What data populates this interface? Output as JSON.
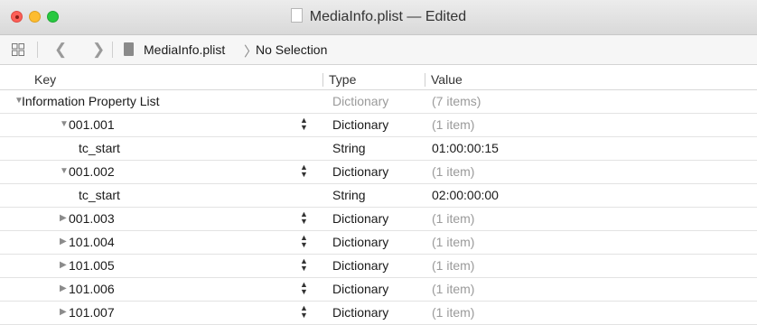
{
  "window": {
    "title": "MediaInfo.plist — Edited"
  },
  "jumpbar": {
    "file": "MediaInfo.plist",
    "selection": "No Selection"
  },
  "columns": {
    "key": "Key",
    "type": "Type",
    "value": "Value"
  },
  "rows": [
    {
      "key": "Information Property List",
      "type": "Dictionary",
      "value": "(7 items)",
      "disclosure": "expanded",
      "depth": 0,
      "stepper": false,
      "type_dim": true
    },
    {
      "key": "001.001",
      "type": "Dictionary",
      "value": "(1 item)",
      "disclosure": "expanded",
      "depth": 1,
      "stepper": true,
      "type_dim": false
    },
    {
      "key": "tc_start",
      "type": "String",
      "value": "01:00:00:15",
      "disclosure": "none",
      "depth": 2,
      "stepper": false,
      "type_dim": false
    },
    {
      "key": "001.002",
      "type": "Dictionary",
      "value": "(1 item)",
      "disclosure": "expanded",
      "depth": 1,
      "stepper": true,
      "type_dim": false
    },
    {
      "key": "tc_start",
      "type": "String",
      "value": "02:00:00:00",
      "disclosure": "none",
      "depth": 2,
      "stepper": false,
      "type_dim": false
    },
    {
      "key": "001.003",
      "type": "Dictionary",
      "value": "(1 item)",
      "disclosure": "collapsed",
      "depth": 1,
      "stepper": true,
      "type_dim": false
    },
    {
      "key": "101.004",
      "type": "Dictionary",
      "value": "(1 item)",
      "disclosure": "collapsed",
      "depth": 1,
      "stepper": true,
      "type_dim": false
    },
    {
      "key": "101.005",
      "type": "Dictionary",
      "value": "(1 item)",
      "disclosure": "collapsed",
      "depth": 1,
      "stepper": true,
      "type_dim": false
    },
    {
      "key": "101.006",
      "type": "Dictionary",
      "value": "(1 item)",
      "disclosure": "collapsed",
      "depth": 1,
      "stepper": true,
      "type_dim": false
    },
    {
      "key": "101.007",
      "type": "Dictionary",
      "value": "(1 item)",
      "disclosure": "collapsed",
      "depth": 1,
      "stepper": true,
      "type_dim": false
    }
  ]
}
